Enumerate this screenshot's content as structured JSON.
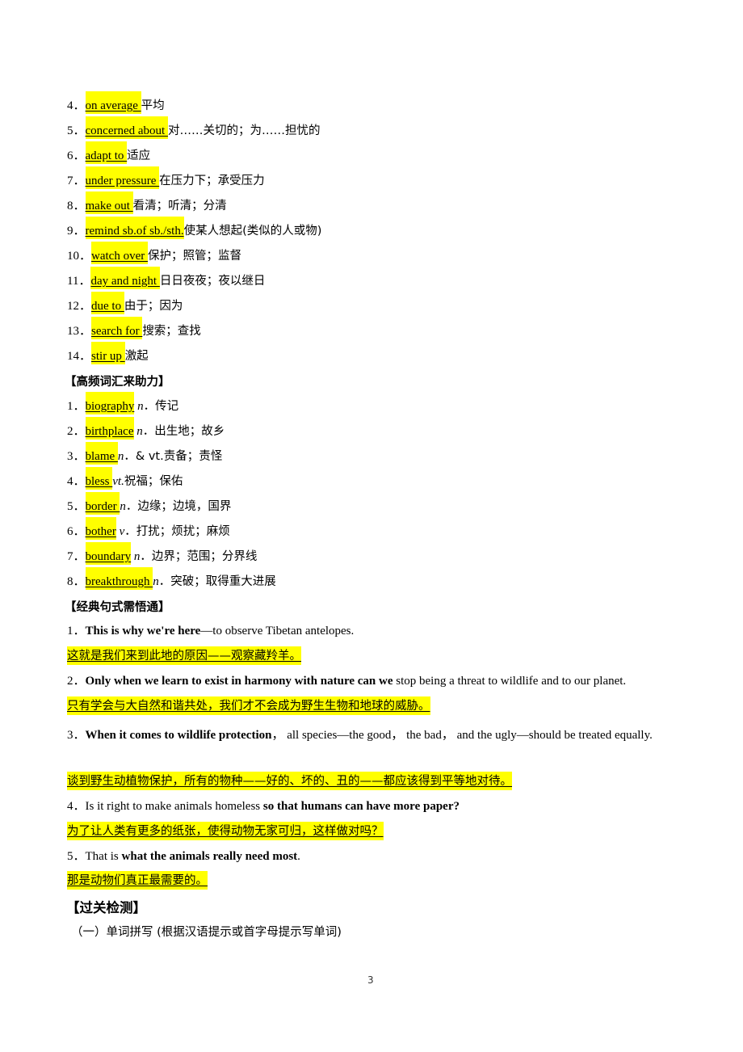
{
  "phrases": [
    {
      "num": "4．",
      "term": "on average ",
      "meaning": "平均"
    },
    {
      "num": "5．",
      "term": "concerned about ",
      "meaning": "对……关切的；为……担忧的"
    },
    {
      "num": "6．",
      "term": "adapt to ",
      "meaning": "适应"
    },
    {
      "num": "7．",
      "term": "under pressure ",
      "meaning": "在压力下；承受压力"
    },
    {
      "num": "8．",
      "term": "make out ",
      "meaning": "看清；听清；分清"
    },
    {
      "num": "9．",
      "term": "remind sb.of sb./sth.",
      "meaning": "使某人想起(类似的人或物)"
    },
    {
      "num": "10．",
      "term": "watch over ",
      "meaning": "保护；照管；监督"
    },
    {
      "num": "11．",
      "term": "day and night ",
      "meaning": "日日夜夜；夜以继日"
    },
    {
      "num": "12．",
      "term": "due to ",
      "meaning": "由于；因为"
    },
    {
      "num": "13．",
      "term": "search for ",
      "meaning": "搜索；查找"
    },
    {
      "num": "14．",
      "term": "stir up ",
      "meaning": "激起"
    }
  ],
  "vocab_heading": "【高频词汇来助力】",
  "vocab": [
    {
      "num": "1．",
      "term": "biography",
      "pos": " n",
      "meaning": "．传记"
    },
    {
      "num": "2．",
      "term": "birthplace",
      "pos": " n",
      "meaning": "．出生地；故乡"
    },
    {
      "num": "3．",
      "term": "blame ",
      "pos": "n",
      "meaning": "．& vt.责备；责怪"
    },
    {
      "num": "4．",
      "term": "bless ",
      "pos": "vt.",
      "meaning": "祝福；保佑"
    },
    {
      "num": "5．",
      "term": "border ",
      "pos": "n",
      "meaning": "．边缘；边境，国界"
    },
    {
      "num": "6．",
      "term": "bother",
      "pos": " v",
      "meaning": "．打扰；烦扰；麻烦"
    },
    {
      "num": "7．",
      "term": "boundary",
      "pos": " n",
      "meaning": "．边界；范围；分界线"
    },
    {
      "num": "8．",
      "term": "breakthrough ",
      "pos": "n",
      "meaning": "．突破；取得重大进展"
    }
  ],
  "sentence_heading": "【经典句式需悟通】",
  "sentences": [
    {
      "num": "1．",
      "pre": "",
      "bold": "This is why we're here",
      "post": "—to observe Tibetan antelopes.",
      "translation": "这就是我们来到此地的原因——观察藏羚羊。"
    },
    {
      "num": "2．",
      "pre": "",
      "bold": "Only when we learn to exist in harmony with nature can we",
      "post": " stop being a threat to wildlife and to our planet.",
      "translation": "只有学会与大自然和谐共处，我们才不会成为野生生物和地球的威胁。"
    },
    {
      "num": "3．",
      "pre": "",
      "bold": "When it comes to wildlife protection",
      "post": "， all species—the good， the bad， and the ugly—should be treated equally.",
      "translation": "谈到野生动植物保护，所有的物种——好的、坏的、丑的——都应该得到平等地对待。"
    },
    {
      "num": "4．",
      "pre": "Is it right to make animals homeless ",
      "bold": "so that humans can have more paper?",
      "post": "",
      "translation": "为了让人类有更多的纸张，使得动物无家可归，这样做对吗？"
    },
    {
      "num": "5．",
      "pre": "That is ",
      "bold": "what the animals really need most",
      "post": ".",
      "translation": "那是动物们真正最需要的。"
    }
  ],
  "check_heading": "【过关检测】",
  "check_sub": "（一）单词拼写 (根据汉语提示或首字母提示写单词)",
  "page_number": "3"
}
